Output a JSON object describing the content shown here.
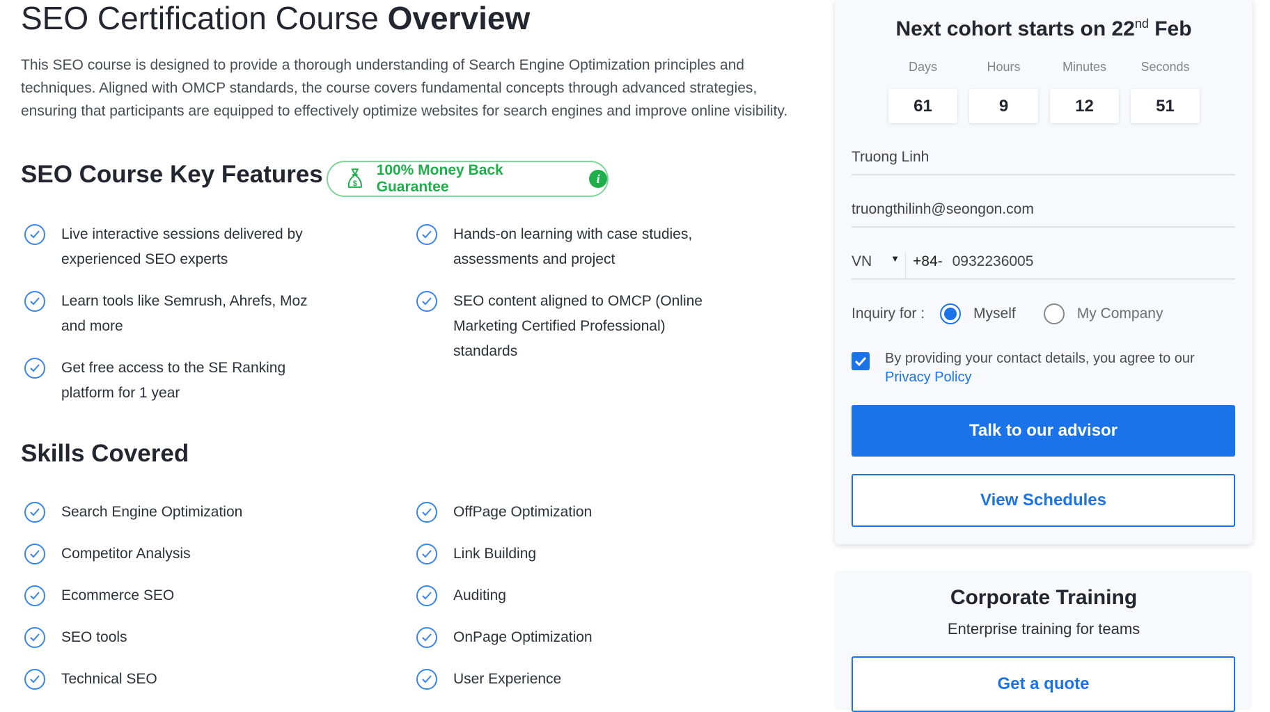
{
  "overview": {
    "title_light": "SEO Certification Course ",
    "title_bold": "Overview",
    "description": "This SEO course is designed to provide a thorough understanding of Search Engine Optimization principles and techniques. Aligned with OMCP standards, the course covers fundamental concepts through advanced strategies, ensuring that participants are equipped to effectively optimize websites for search engines and improve online visibility."
  },
  "features": {
    "heading": "SEO Course Key Features",
    "badge": "100% Money Back Guarantee",
    "items": [
      "Live interactive sessions delivered by experienced SEO experts",
      "Hands-on learning with case studies, assessments and project",
      "Learn tools like Semrush, Ahrefs, Moz and more",
      "SEO content aligned to OMCP (Online Marketing Certified Professional) standards",
      "Get free access to the SE Ranking platform for 1 year"
    ]
  },
  "skills": {
    "heading": "Skills Covered",
    "items": [
      "Search Engine Optimization",
      "OffPage Optimization",
      "Competitor Analysis",
      "Link Building",
      "Ecommerce SEO",
      "Auditing",
      "SEO tools",
      "OnPage Optimization",
      "Technical SEO",
      "User Experience"
    ]
  },
  "form": {
    "title_pre": "Next cohort starts on 22",
    "title_sup": "nd",
    "title_post": " Feb",
    "countdown": [
      {
        "label": "Days",
        "value": "61"
      },
      {
        "label": "Hours",
        "value": "9"
      },
      {
        "label": "Minutes",
        "value": "12"
      },
      {
        "label": "Seconds",
        "value": "51"
      }
    ],
    "name": "Truong Linh",
    "email": "truongthilinh@seongon.com",
    "country": "VN",
    "dial_code": "+84-",
    "phone": "0932236005",
    "inquiry_label": "Inquiry for :",
    "inquiry_options": [
      "Myself",
      "My Company"
    ],
    "inquiry_selected": "Myself",
    "consent_text": "By providing your contact details, you agree to our",
    "consent_link": "Privacy Policy",
    "consent_checked": true,
    "primary_button": "Talk to our advisor",
    "secondary_button": "View Schedules"
  },
  "corporate": {
    "title": "Corporate Training",
    "subtitle": "Enterprise training for teams",
    "button": "Get a quote"
  },
  "colors": {
    "accent": "#1a73e8",
    "success": "#1fae4b"
  }
}
